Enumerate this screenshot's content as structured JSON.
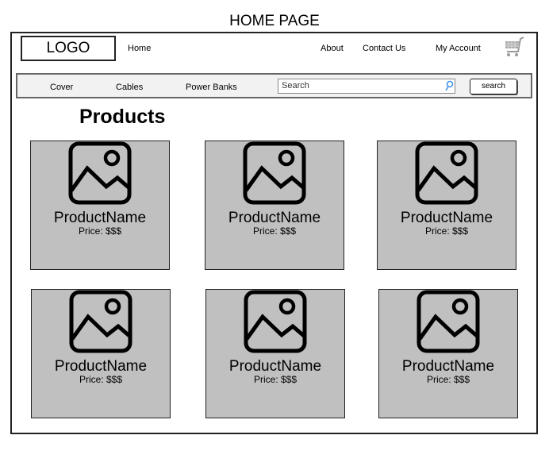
{
  "page_title": "HOME PAGE",
  "header": {
    "logo": "LOGO",
    "nav": {
      "home": "Home",
      "about": "About",
      "contact": "Contact Us",
      "account": "My Account"
    }
  },
  "navbar": {
    "categories": [
      "Cover",
      "Cables",
      "Power Banks"
    ],
    "search_placeholder": "Search",
    "search_button": "search"
  },
  "main": {
    "heading": "Products",
    "products": [
      {
        "name": "ProductName",
        "price": "Price: $$$"
      },
      {
        "name": "ProductName",
        "price": "Price: $$$"
      },
      {
        "name": "ProductName",
        "price": "Price: $$$"
      },
      {
        "name": "ProductName",
        "price": "Price: $$$"
      },
      {
        "name": "ProductName",
        "price": "Price: $$$"
      },
      {
        "name": "ProductName",
        "price": "Price: $$$"
      }
    ]
  }
}
